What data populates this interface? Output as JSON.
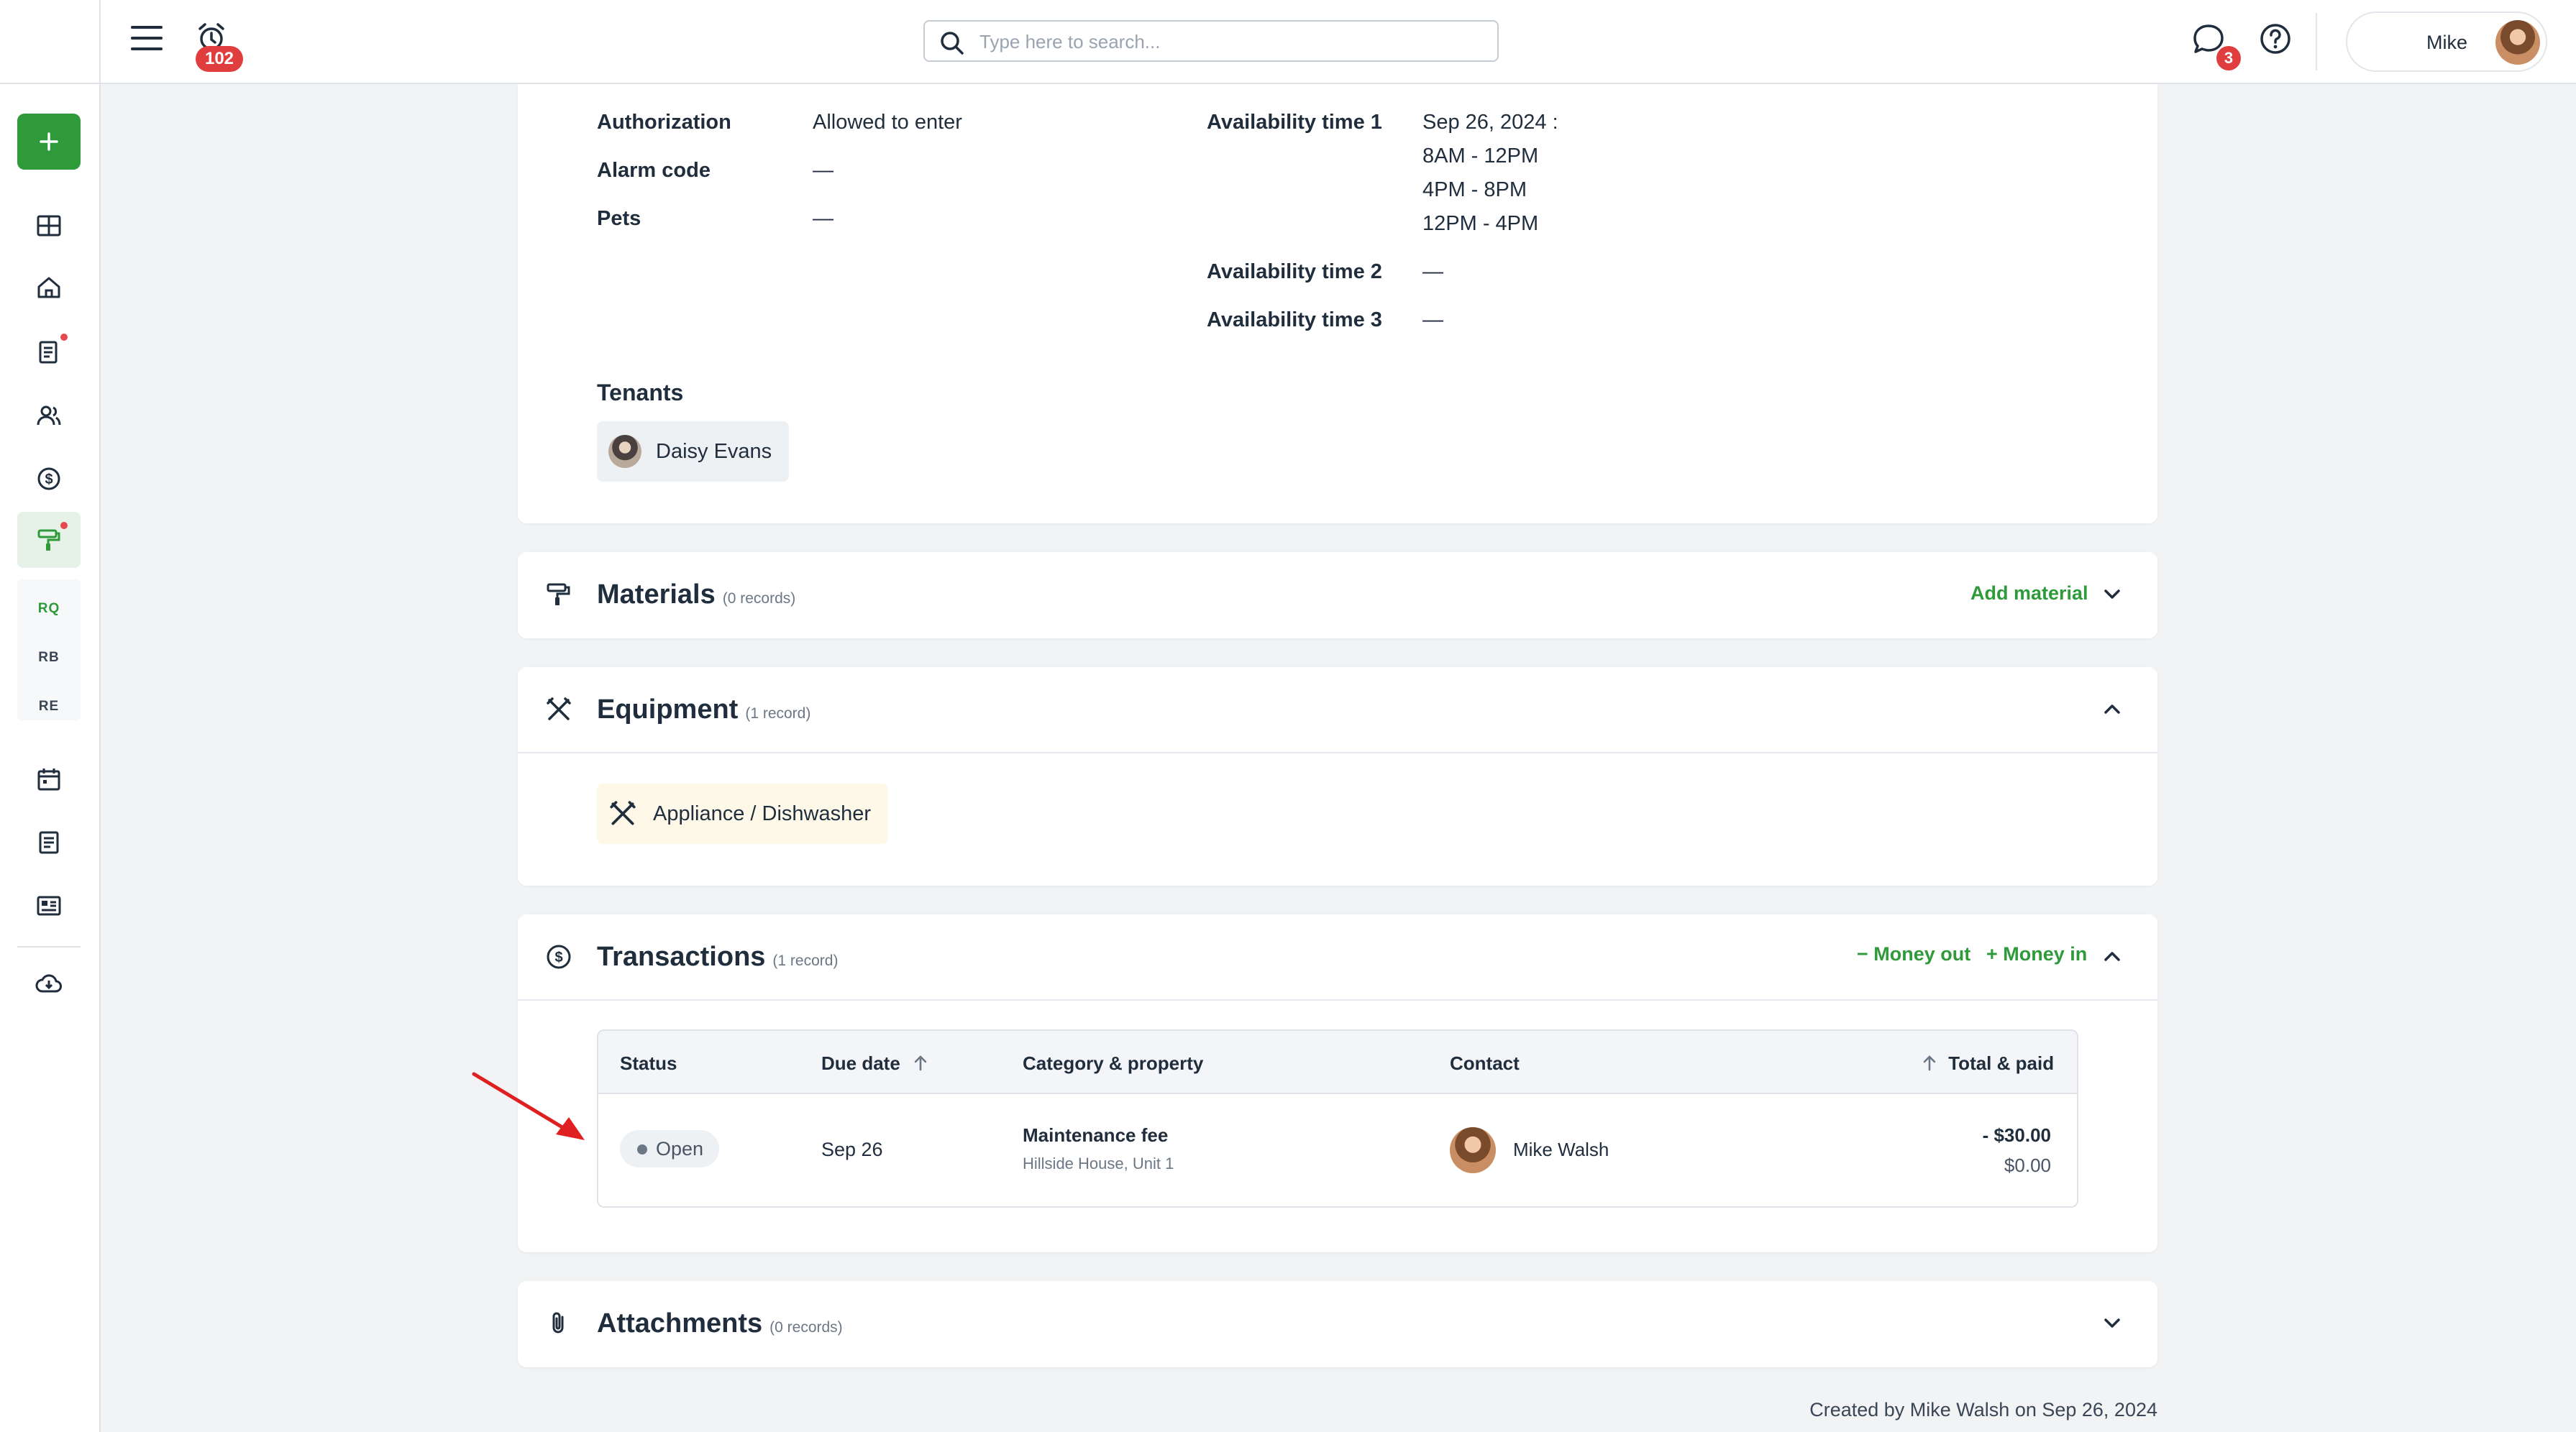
{
  "header": {
    "alarm_badge": "102",
    "search_placeholder": "Type here to search...",
    "chat_badge": "3",
    "user_name": "Mike"
  },
  "sidebar": {
    "sub_items": [
      "RQ",
      "RB",
      "RE"
    ]
  },
  "details": {
    "authorization_label": "Authorization",
    "authorization_value": "Allowed to enter",
    "alarm_code_label": "Alarm code",
    "alarm_code_value": "—",
    "pets_label": "Pets",
    "pets_value": "—",
    "avail1_label": "Availability time 1",
    "avail1_date": "Sep 26, 2024 :",
    "avail1_slots": [
      "8AM - 12PM",
      "4PM - 8PM",
      "12PM - 4PM"
    ],
    "avail2_label": "Availability time 2",
    "avail2_value": "—",
    "avail3_label": "Availability time 3",
    "avail3_value": "—",
    "tenants_label": "Tenants",
    "tenant_name": "Daisy Evans"
  },
  "materials": {
    "title": "Materials",
    "count": "(0 records)",
    "add_label": "Add material"
  },
  "equipment": {
    "title": "Equipment",
    "count": "(1 record)",
    "item": "Appliance / Dishwasher"
  },
  "transactions": {
    "title": "Transactions",
    "count": "(1 record)",
    "money_out": "Money out",
    "money_in": "Money in",
    "columns": {
      "status": "Status",
      "due_date": "Due date",
      "category": "Category & property",
      "contact": "Contact",
      "total": "Total & paid"
    },
    "rows": [
      {
        "status": "Open",
        "due_date": "Sep 26",
        "category": "Maintenance fee",
        "property": "Hillside House, Unit 1",
        "contact": "Mike Walsh",
        "total": "- $30.00",
        "paid": "$0.00"
      }
    ]
  },
  "attachments": {
    "title": "Attachments",
    "count": "(0 records)"
  },
  "footer": {
    "created": "Created by Mike Walsh on Sep 26, 2024"
  },
  "colors": {
    "accent_green": "#2e9a3a",
    "badge_red": "#e03e3e",
    "annotation_arrow": "#e02020"
  }
}
